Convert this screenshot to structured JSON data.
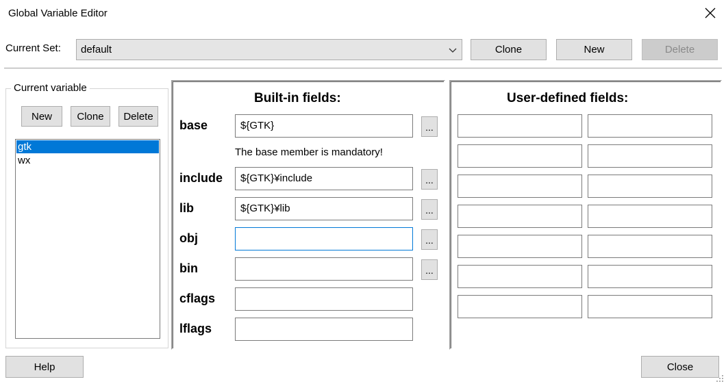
{
  "window": {
    "title": "Global Variable Editor"
  },
  "current_set": {
    "label": "Current Set:",
    "value": "default"
  },
  "set_buttons": {
    "clone": "Clone",
    "new": "New",
    "delete": "Delete"
  },
  "current_variable": {
    "group_label": "Current variable",
    "buttons": {
      "new": "New",
      "clone": "Clone",
      "delete": "Delete"
    },
    "items": [
      {
        "label": "gtk",
        "selected": true
      },
      {
        "label": "wx",
        "selected": false
      }
    ]
  },
  "builtin": {
    "heading": "Built-in fields:",
    "base_note": "The base member is mandatory!",
    "fields": [
      {
        "label": "base",
        "value": "${GTK}"
      },
      {
        "label": "include",
        "value": "${GTK}¥include"
      },
      {
        "label": "lib",
        "value": "${GTK}¥lib"
      },
      {
        "label": "obj",
        "value": ""
      },
      {
        "label": "bin",
        "value": ""
      },
      {
        "label": "cflags",
        "value": ""
      },
      {
        "label": "lflags",
        "value": ""
      }
    ],
    "browse_label": "..."
  },
  "user_defined": {
    "heading": "User-defined fields:"
  },
  "footer": {
    "help": "Help",
    "close": "Close"
  },
  "icons": {
    "close": "close-icon",
    "dropdown": "chevron-down-icon",
    "grip": "resize-grip-icon"
  }
}
